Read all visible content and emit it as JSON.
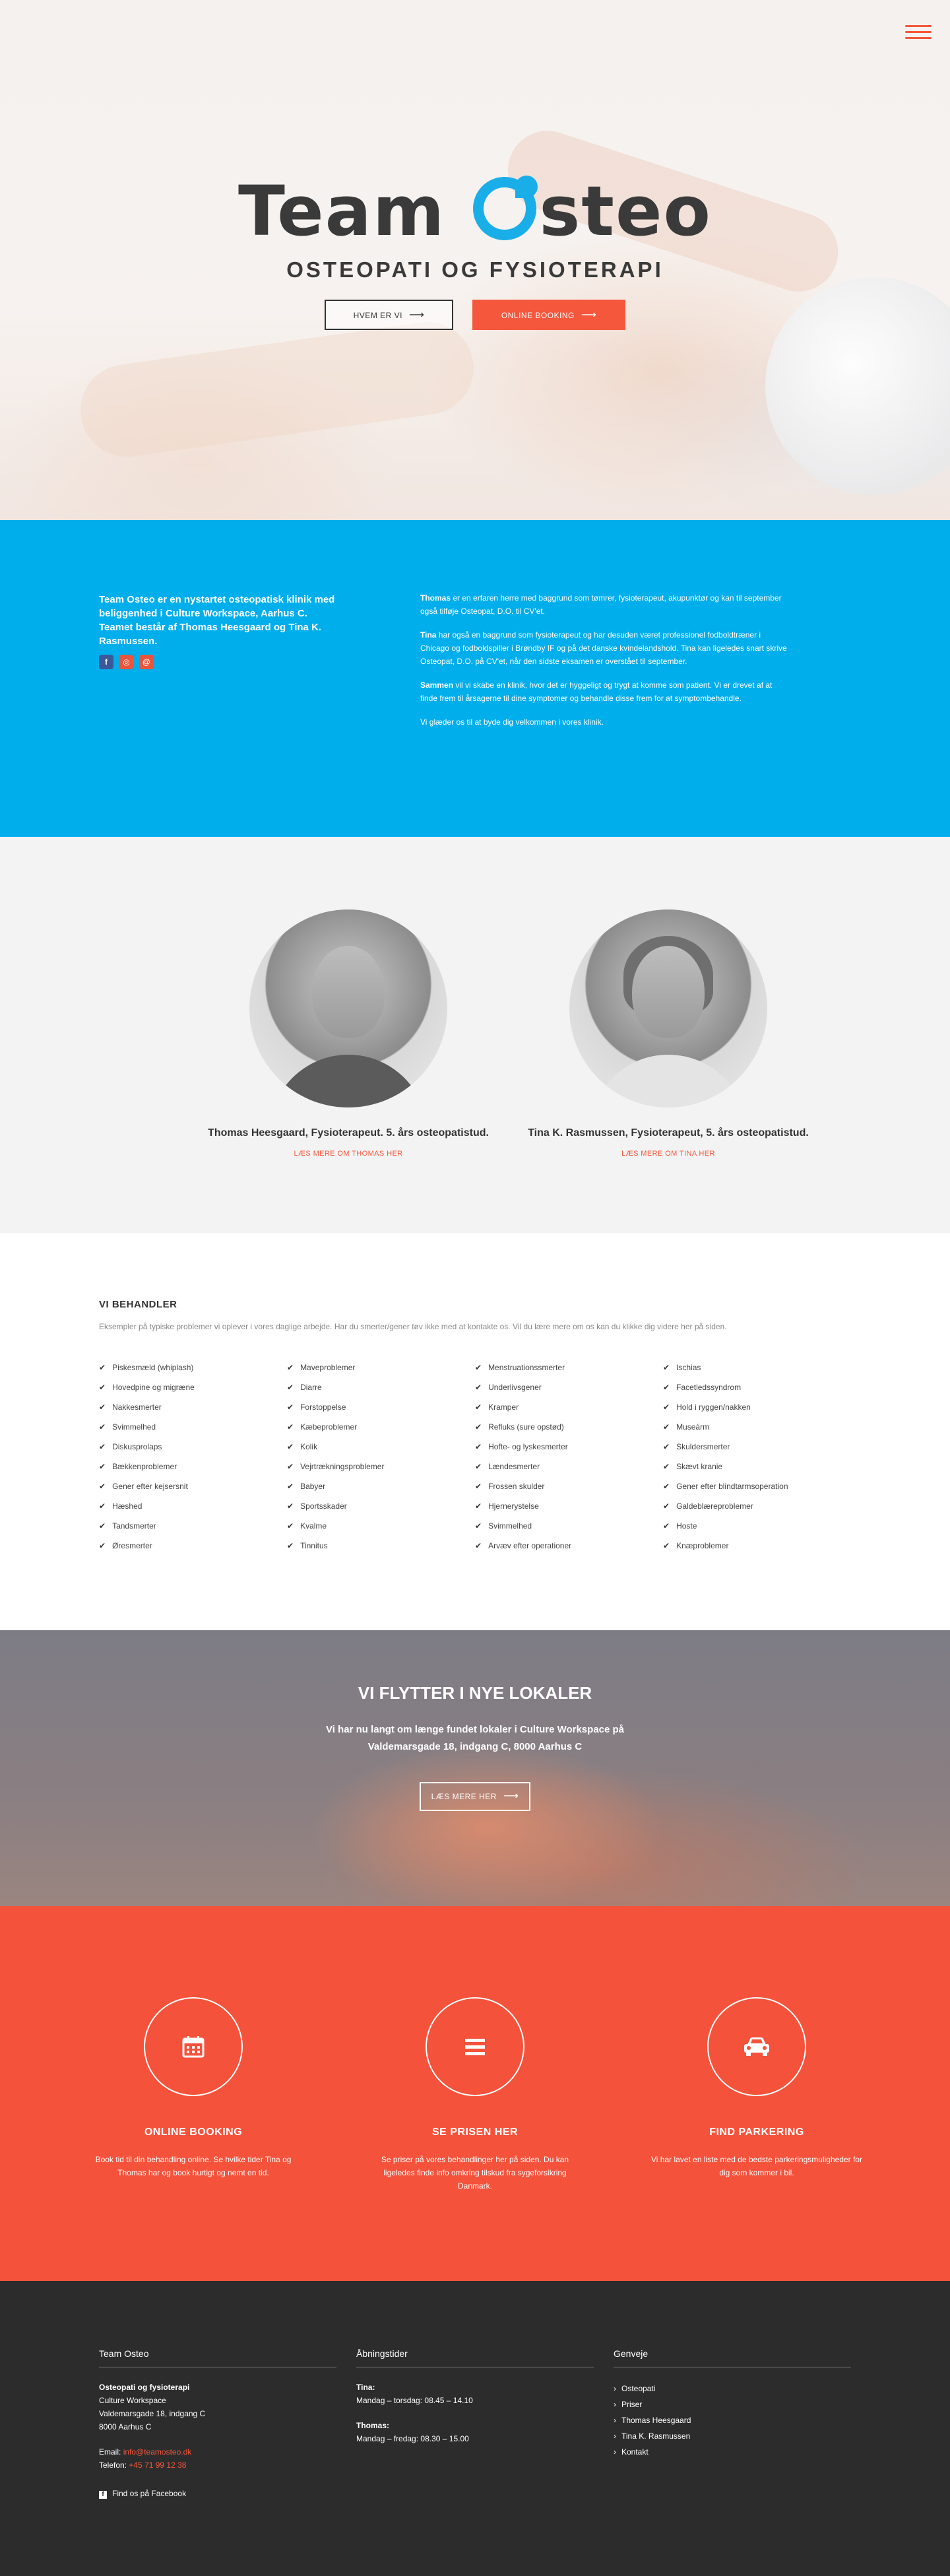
{
  "hero": {
    "logo_team": "Team",
    "logo_osteo": "steo",
    "logo_sub": "OSTEOPATI OG FYSIOTERAPI",
    "btn_who": "HVEM ER VI",
    "btn_booking": "ONLINE BOOKING",
    "menu_icon": "hamburger-icon"
  },
  "about": {
    "intro": "Team Osteo er en nystartet osteopatisk klinik med beliggenhed i Culture Workspace, Aarhus C. Teamet består af Thomas Heesgaard og Tina K. Rasmussen.",
    "p1_name": "Thomas",
    "p1_text": " er en erfaren herre med baggrund som tømrer, fysioterapeut, akupunktør og kan til september også tilføje Osteopat, D.O. til CV'et.",
    "p2_name": "Tina",
    "p2_text": " har også en baggrund som fysioterapeut og har desuden været professionel fodboldtræner i Chicago og fodboldspiller i Brøndby IF og på det danske kvindelandshold. Tina kan ligeledes snart skrive Osteopat, D.O. på CV'et, når den sidste eksamen er overstået til september.",
    "p3_name": "Sammen",
    "p3_text": " vil vi skabe en klinik, hvor det er hyggeligt og trygt at komme som patient. Vi er drevet af at finde frem til årsagerne til dine symptomer og behandle disse frem for at symptombehandle.",
    "p4": "Vi glæder os til at byde dig velkommen i vores klinik."
  },
  "team": {
    "thomas_name": "Thomas Heesgaard, Fysioterapeut. 5. års osteopatistud.",
    "thomas_link": "LÆS MERE OM THOMAS HER",
    "tina_name": "Tina K. Rasmussen, Fysioterapeut, 5. års osteopatistud.",
    "tina_link": "LÆS MERE OM TINA HER"
  },
  "treatments": {
    "title": "VI BEHANDLER",
    "intro": "Eksempler på typiske problemer vi oplever i vores daglige arbejde. Har du smerter/gener tøv ikke med at kontakte os. Vil du lære mere om os kan du klikke dig videre her på siden.",
    "col1": [
      "Piskesmæld (whiplash)",
      "Hovedpine og migræne",
      "Nakkesmerter",
      "Svimmelhed",
      "Diskusprolaps",
      "Bækkenproblemer",
      "Gener efter kejsersnit",
      "Hæshed",
      "Tandsmerter",
      "Øresmerter"
    ],
    "col2": [
      "Maveproblemer",
      "Diarre",
      "Forstoppelse",
      "Kæbeproblemer",
      "Kolik",
      "Vejrtrækningsproblemer",
      "Babyer",
      "Sportsskader",
      "Kvalme",
      "Tinnitus"
    ],
    "col3": [
      "Menstruationssmerter",
      "Underlivsgener",
      "Kramper",
      "Refluks (sure opstød)",
      "Hofte- og lyskesmerter",
      "Lændesmerter",
      "Frossen skulder",
      "Hjernerystelse",
      "Svimmelhed",
      "Arvæv efter operationer"
    ],
    "col4": [
      "Ischias",
      "Facetledssyndrom",
      "Hold i ryggen/nakken",
      "Museárm",
      "Skuldersmerter",
      "Skævt kranie",
      "Gener efter blindtarmsoperation",
      "Galdeblæreproblemer",
      "Hoste",
      "Knæproblemer"
    ]
  },
  "move": {
    "title": "VI FLYTTER I NYE LOKALER",
    "text": "Vi har nu langt om længe fundet lokaler i Culture Workspace på Valdemarsgade 18, indgang C, 8000 Aarhus C",
    "btn": "LÆS MERE HER"
  },
  "features": {
    "f1_title": "ONLINE BOOKING",
    "f1_text": "Book tid til din behandling online. Se hvilke tider Tina og Thomas har og book hurtigt og nemt en tid.",
    "f1_icon": "calendar-icon",
    "f2_title": "SE PRISEN HER",
    "f2_text": "Se priser på vores behandlinger her på siden. Du kan ligeledes finde info omkring tilskud fra sygeforsikring Danmark.",
    "f2_icon": "list-icon",
    "f3_title": "FIND PARKERING",
    "f3_text": "Vi har lavet en liste med de bedste parkeringsmuligheder for dig som kommer i bil.",
    "f3_icon": "car-icon"
  },
  "footer": {
    "col1_title": "Team Osteo",
    "company": "Osteopati og fysioterapi",
    "addr1": "Culture Workspace",
    "addr2": "Valdemarsgade 18, indgang C",
    "addr3": "8000 Aarhus C",
    "email_label": "Email: ",
    "email": "info@teamosteo.dk",
    "phone_label": "Telefon: ",
    "phone": "+45 71 99 12 38",
    "facebook": "Find os på Facebook",
    "col2_title": "Åbningstider",
    "tina_label": "Tina:",
    "tina_hours": "Mandag – torsdag: 08.45 – 14.10",
    "thomas_label": "Thomas:",
    "thomas_hours": "Mandag – fredag: 08.30 – 15.00",
    "col3_title": "Genveje",
    "links": [
      "Osteopati",
      "Priser",
      "Thomas Heesgaard",
      "Tina K. Rasmussen",
      "Kontakt"
    ]
  },
  "colors": {
    "accent_red": "#f4573b",
    "accent_blue": "#00aeeb",
    "footer_bg": "#2c2c2c"
  }
}
